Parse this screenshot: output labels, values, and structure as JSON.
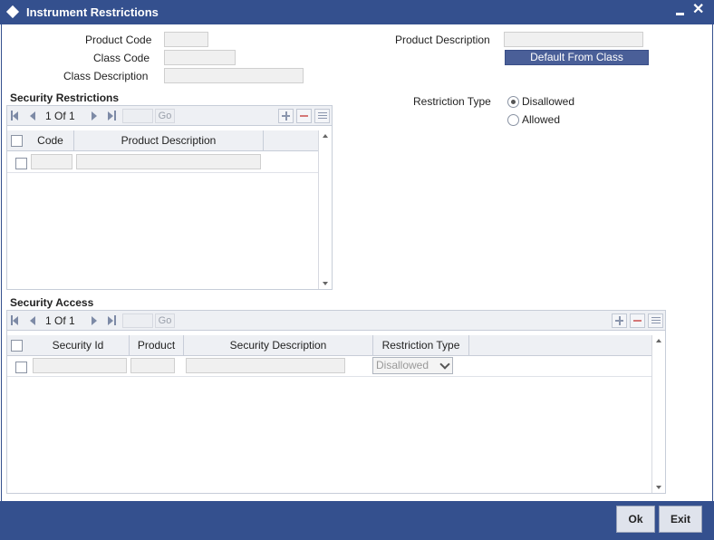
{
  "window": {
    "title": "Instrument Restrictions"
  },
  "header": {
    "product_code_label": "Product Code",
    "class_code_label": "Class Code",
    "class_description_label": "Class Description",
    "product_description_label": "Product Description",
    "default_from_class_label": "Default From Class"
  },
  "restriction": {
    "label": "Restriction Type",
    "options": [
      {
        "label": "Disallowed",
        "selected": true
      },
      {
        "label": "Allowed",
        "selected": false
      }
    ]
  },
  "security_restrictions": {
    "title": "Security Restrictions",
    "pager": {
      "page_info": "1 Of 1",
      "go_label": "Go"
    },
    "columns": [
      "Code",
      "Product Description"
    ]
  },
  "security_access": {
    "title": "Security Access",
    "pager": {
      "page_info": "1 Of 1",
      "go_label": "Go"
    },
    "columns": [
      "Security Id",
      "Product",
      "Security Description",
      "Restriction Type"
    ],
    "row_restriction_value": "Disallowed"
  },
  "footer": {
    "ok_label": "Ok",
    "exit_label": "Exit"
  },
  "colors": {
    "titlebar": "#34508e",
    "button": "#4a5f98"
  }
}
